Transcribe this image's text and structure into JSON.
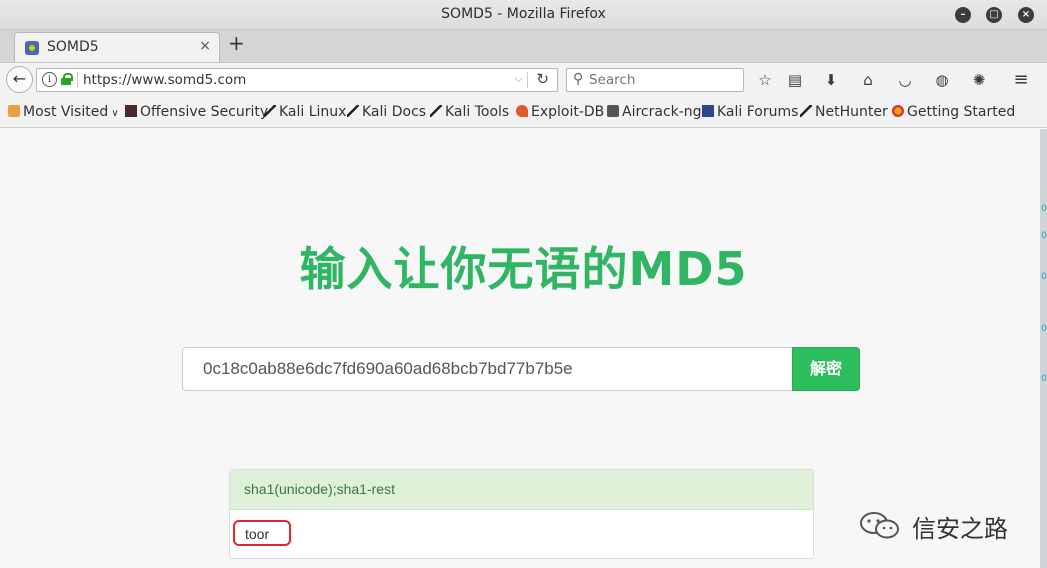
{
  "window": {
    "title": "SOMD5 - Mozilla Firefox"
  },
  "tab": {
    "label": "SOMD5",
    "close": "×",
    "new_tab": "+"
  },
  "navbar": {
    "url": "https://www.somd5.com",
    "search_placeholder": "Search"
  },
  "bookmarks": [
    {
      "label": "Most Visited"
    },
    {
      "label": "Offensive Security"
    },
    {
      "label": "Kali Linux"
    },
    {
      "label": "Kali Docs"
    },
    {
      "label": "Kali Tools"
    },
    {
      "label": "Exploit-DB"
    },
    {
      "label": "Aircrack-ng"
    },
    {
      "label": "Kali Forums"
    },
    {
      "label": "NetHunter"
    },
    {
      "label": "Getting Started"
    }
  ],
  "page": {
    "headline": "输入让你无语的MD5",
    "hash_value": "0c18c0ab88e6dc7fd690a60ad68bcb7bd77b7b5e",
    "decrypt_button": "解密",
    "result_type": "sha1(unicode);sha1-rest",
    "result_value": "toor"
  },
  "watermark": {
    "text": "信安之路"
  },
  "colors": {
    "accent_green": "#2fb564",
    "button_green": "#2fbe5e",
    "result_bg": "#dff0d8",
    "highlight_red": "#e0262a"
  }
}
